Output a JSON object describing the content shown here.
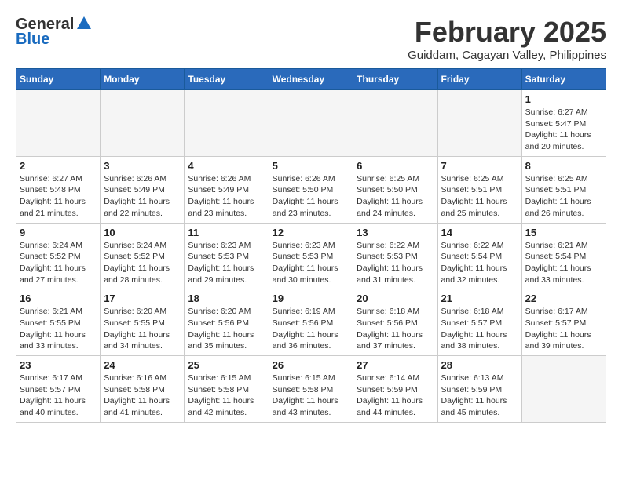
{
  "logo": {
    "line1": "General",
    "line2": "Blue"
  },
  "title": "February 2025",
  "subtitle": "Guiddam, Cagayan Valley, Philippines",
  "weekdays": [
    "Sunday",
    "Monday",
    "Tuesday",
    "Wednesday",
    "Thursday",
    "Friday",
    "Saturday"
  ],
  "weeks": [
    [
      {
        "day": "",
        "info": ""
      },
      {
        "day": "",
        "info": ""
      },
      {
        "day": "",
        "info": ""
      },
      {
        "day": "",
        "info": ""
      },
      {
        "day": "",
        "info": ""
      },
      {
        "day": "",
        "info": ""
      },
      {
        "day": "1",
        "info": "Sunrise: 6:27 AM\nSunset: 5:47 PM\nDaylight: 11 hours\nand 20 minutes."
      }
    ],
    [
      {
        "day": "2",
        "info": "Sunrise: 6:27 AM\nSunset: 5:48 PM\nDaylight: 11 hours\nand 21 minutes."
      },
      {
        "day": "3",
        "info": "Sunrise: 6:26 AM\nSunset: 5:49 PM\nDaylight: 11 hours\nand 22 minutes."
      },
      {
        "day": "4",
        "info": "Sunrise: 6:26 AM\nSunset: 5:49 PM\nDaylight: 11 hours\nand 23 minutes."
      },
      {
        "day": "5",
        "info": "Sunrise: 6:26 AM\nSunset: 5:50 PM\nDaylight: 11 hours\nand 23 minutes."
      },
      {
        "day": "6",
        "info": "Sunrise: 6:25 AM\nSunset: 5:50 PM\nDaylight: 11 hours\nand 24 minutes."
      },
      {
        "day": "7",
        "info": "Sunrise: 6:25 AM\nSunset: 5:51 PM\nDaylight: 11 hours\nand 25 minutes."
      },
      {
        "day": "8",
        "info": "Sunrise: 6:25 AM\nSunset: 5:51 PM\nDaylight: 11 hours\nand 26 minutes."
      }
    ],
    [
      {
        "day": "9",
        "info": "Sunrise: 6:24 AM\nSunset: 5:52 PM\nDaylight: 11 hours\nand 27 minutes."
      },
      {
        "day": "10",
        "info": "Sunrise: 6:24 AM\nSunset: 5:52 PM\nDaylight: 11 hours\nand 28 minutes."
      },
      {
        "day": "11",
        "info": "Sunrise: 6:23 AM\nSunset: 5:53 PM\nDaylight: 11 hours\nand 29 minutes."
      },
      {
        "day": "12",
        "info": "Sunrise: 6:23 AM\nSunset: 5:53 PM\nDaylight: 11 hours\nand 30 minutes."
      },
      {
        "day": "13",
        "info": "Sunrise: 6:22 AM\nSunset: 5:53 PM\nDaylight: 11 hours\nand 31 minutes."
      },
      {
        "day": "14",
        "info": "Sunrise: 6:22 AM\nSunset: 5:54 PM\nDaylight: 11 hours\nand 32 minutes."
      },
      {
        "day": "15",
        "info": "Sunrise: 6:21 AM\nSunset: 5:54 PM\nDaylight: 11 hours\nand 33 minutes."
      }
    ],
    [
      {
        "day": "16",
        "info": "Sunrise: 6:21 AM\nSunset: 5:55 PM\nDaylight: 11 hours\nand 33 minutes."
      },
      {
        "day": "17",
        "info": "Sunrise: 6:20 AM\nSunset: 5:55 PM\nDaylight: 11 hours\nand 34 minutes."
      },
      {
        "day": "18",
        "info": "Sunrise: 6:20 AM\nSunset: 5:56 PM\nDaylight: 11 hours\nand 35 minutes."
      },
      {
        "day": "19",
        "info": "Sunrise: 6:19 AM\nSunset: 5:56 PM\nDaylight: 11 hours\nand 36 minutes."
      },
      {
        "day": "20",
        "info": "Sunrise: 6:18 AM\nSunset: 5:56 PM\nDaylight: 11 hours\nand 37 minutes."
      },
      {
        "day": "21",
        "info": "Sunrise: 6:18 AM\nSunset: 5:57 PM\nDaylight: 11 hours\nand 38 minutes."
      },
      {
        "day": "22",
        "info": "Sunrise: 6:17 AM\nSunset: 5:57 PM\nDaylight: 11 hours\nand 39 minutes."
      }
    ],
    [
      {
        "day": "23",
        "info": "Sunrise: 6:17 AM\nSunset: 5:57 PM\nDaylight: 11 hours\nand 40 minutes."
      },
      {
        "day": "24",
        "info": "Sunrise: 6:16 AM\nSunset: 5:58 PM\nDaylight: 11 hours\nand 41 minutes."
      },
      {
        "day": "25",
        "info": "Sunrise: 6:15 AM\nSunset: 5:58 PM\nDaylight: 11 hours\nand 42 minutes."
      },
      {
        "day": "26",
        "info": "Sunrise: 6:15 AM\nSunset: 5:58 PM\nDaylight: 11 hours\nand 43 minutes."
      },
      {
        "day": "27",
        "info": "Sunrise: 6:14 AM\nSunset: 5:59 PM\nDaylight: 11 hours\nand 44 minutes."
      },
      {
        "day": "28",
        "info": "Sunrise: 6:13 AM\nSunset: 5:59 PM\nDaylight: 11 hours\nand 45 minutes."
      },
      {
        "day": "",
        "info": ""
      }
    ]
  ]
}
